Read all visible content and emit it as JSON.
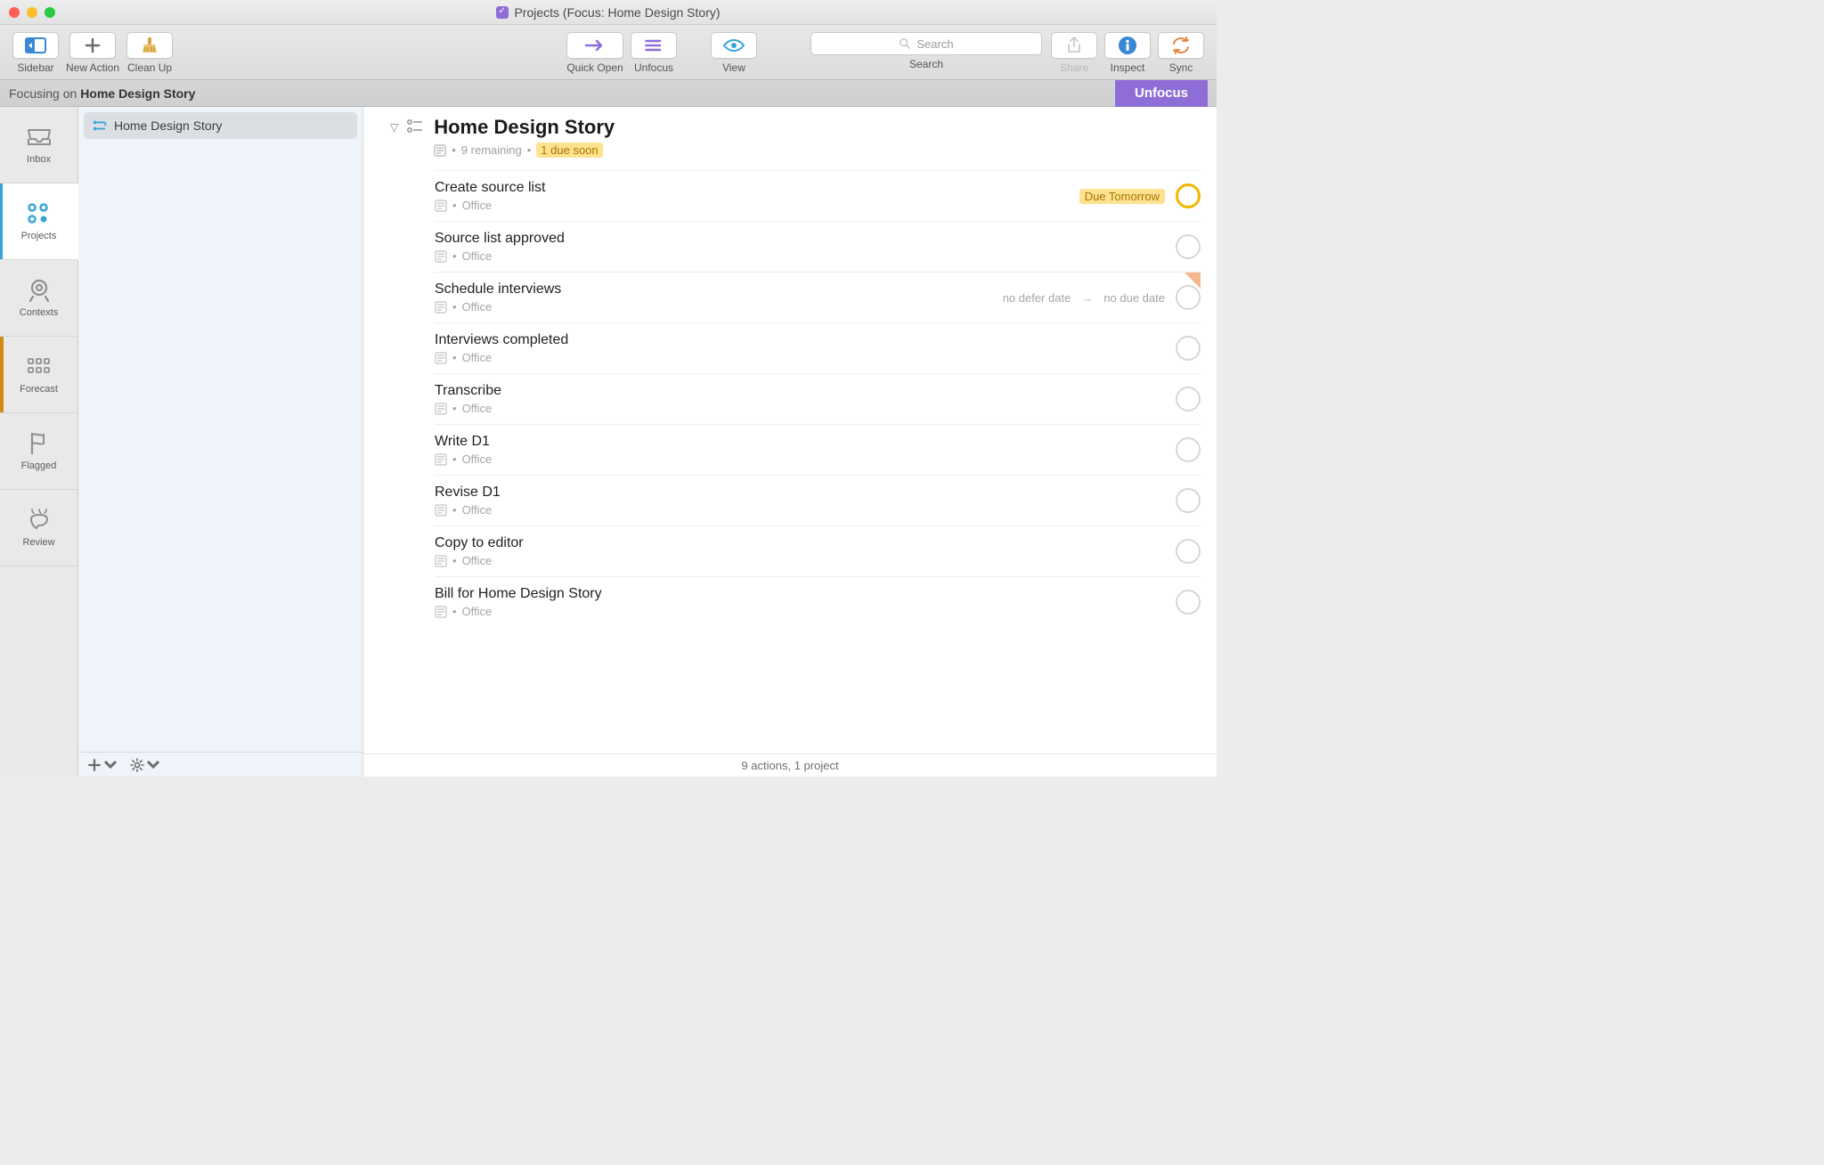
{
  "window": {
    "title": "Projects (Focus: Home Design Story)"
  },
  "toolbar": {
    "sidebar": "Sidebar",
    "new_action": "New Action",
    "clean_up": "Clean Up",
    "quick_open": "Quick Open",
    "unfocus": "Unfocus",
    "view": "View",
    "share": "Share",
    "inspect": "Inspect",
    "sync": "Sync",
    "search_label": "Search",
    "search_placeholder": "Search"
  },
  "focusbar": {
    "prefix": "Focusing on",
    "project": "Home Design Story",
    "unfocus": "Unfocus"
  },
  "rail": {
    "inbox": "Inbox",
    "projects": "Projects",
    "contexts": "Contexts",
    "forecast": "Forecast",
    "flagged": "Flagged",
    "review": "Review"
  },
  "sidebar": {
    "project_name": "Home Design Story"
  },
  "content": {
    "title": "Home Design Story",
    "remaining": "9 remaining",
    "due_soon": "1 due soon",
    "tasks": [
      {
        "name": "Create source list",
        "context": "Office",
        "badge": "Due Tomorrow",
        "circle": "due"
      },
      {
        "name": "Source list approved",
        "context": "Office"
      },
      {
        "name": "Schedule interviews",
        "context": "Office",
        "defer_text": "no defer date",
        "due_text": "no due date",
        "flagged": true
      },
      {
        "name": "Interviews completed",
        "context": "Office"
      },
      {
        "name": "Transcribe",
        "context": "Office"
      },
      {
        "name": "Write D1",
        "context": "Office"
      },
      {
        "name": "Revise D1",
        "context": "Office"
      },
      {
        "name": "Copy to editor",
        "context": "Office"
      },
      {
        "name": "Bill for Home Design Story",
        "context": "Office"
      }
    ]
  },
  "statusbar": "9 actions, 1 project"
}
